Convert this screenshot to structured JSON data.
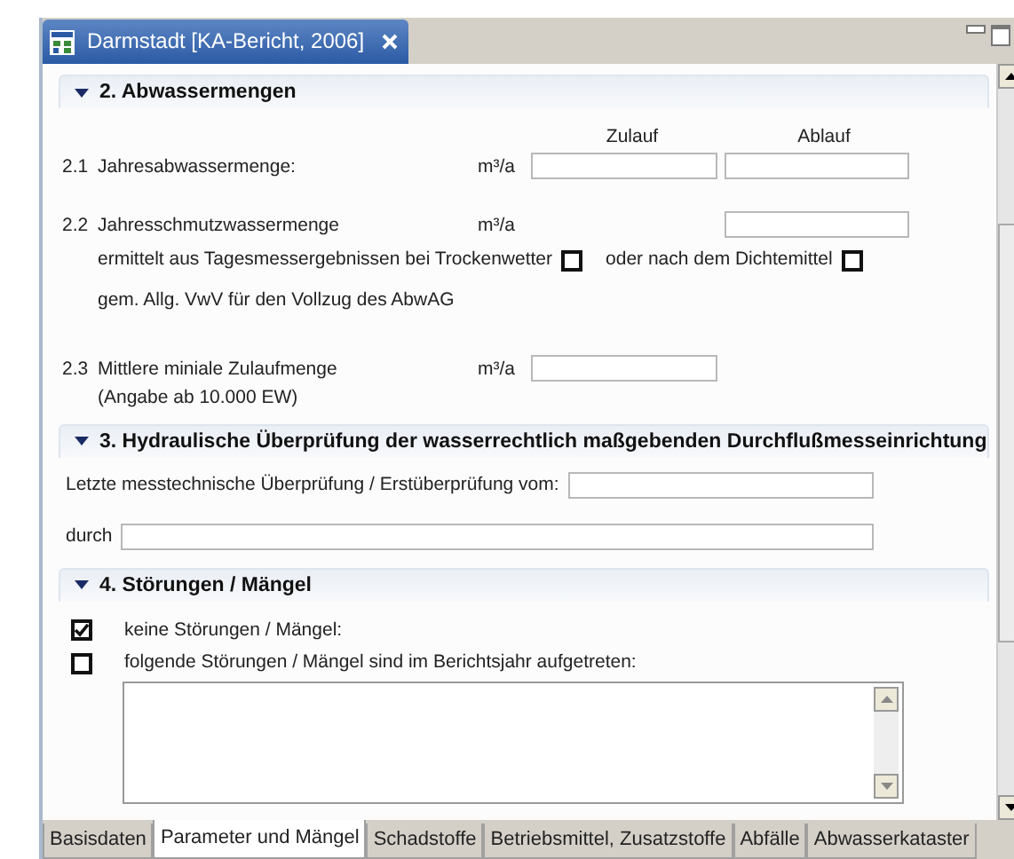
{
  "editor_tab": {
    "title": "Darmstadt [KA-Bericht, 2006]"
  },
  "sections": [
    {
      "title": "2. Abwassermengen",
      "expanded": true,
      "rows": [
        {
          "kind": "headers",
          "labels": [
            "Zulauf",
            "Ablauf"
          ]
        },
        {
          "kind": "quantity",
          "number": "2.1",
          "label": "Jahresabwassermenge:",
          "unit": "m³/a",
          "zulauf_field": true,
          "ablauf_field": true
        },
        {
          "kind": "quantity",
          "number": "2.2",
          "label": "Jahresschmutzwassermenge",
          "unit": "m³/a",
          "zulauf_field": false,
          "ablauf_field": true
        },
        {
          "kind": "inline_checks",
          "items": [
            {
              "label": "ermittelt aus Tagesmessergebnissen bei Trockenwetter",
              "checked": false
            },
            {
              "label": "oder nach dem Dichtemittel",
              "checked": false
            }
          ]
        },
        {
          "kind": "note",
          "text": "gem. Allg. VwV für den Vollzug des AbwAG"
        },
        {
          "kind": "quantity",
          "number": "2.3",
          "label": "Mittlere miniale Zulaufmenge",
          "sublabel": "(Angabe ab 10.000 EW)",
          "unit": "m³/a",
          "zulauf_field": true,
          "ablauf_field": false
        }
      ]
    },
    {
      "title": "3. Hydraulische Überprüfung der wasserrechtlich maßgebenden Durchflußmesseinrichtung",
      "expanded": true,
      "rows": [
        {
          "kind": "field",
          "label": "Letzte messtechnische Überprüfung / Erstüberprüfung vom:"
        },
        {
          "kind": "field",
          "label": "durch"
        }
      ]
    },
    {
      "title": "4. Störungen / Mängel",
      "expanded": true,
      "rows": [
        {
          "kind": "checkbox",
          "label": "keine Störungen / Mängel:",
          "checked": true
        },
        {
          "kind": "checkbox",
          "label": "folgende Störungen / Mängel sind im Berichtsjahr aufgetreten:",
          "checked": false
        },
        {
          "kind": "textarea"
        }
      ]
    }
  ],
  "bottom_tabs": [
    {
      "label": "Basisdaten",
      "selected": false
    },
    {
      "label": "Parameter und Mängel",
      "selected": true
    },
    {
      "label": "Schadstoffe",
      "selected": false
    },
    {
      "label": "Betriebsmittel, Zusatzstoffe",
      "selected": false
    },
    {
      "label": "Abfälle",
      "selected": false
    },
    {
      "label": "Abwasserkataster",
      "selected": false
    }
  ]
}
